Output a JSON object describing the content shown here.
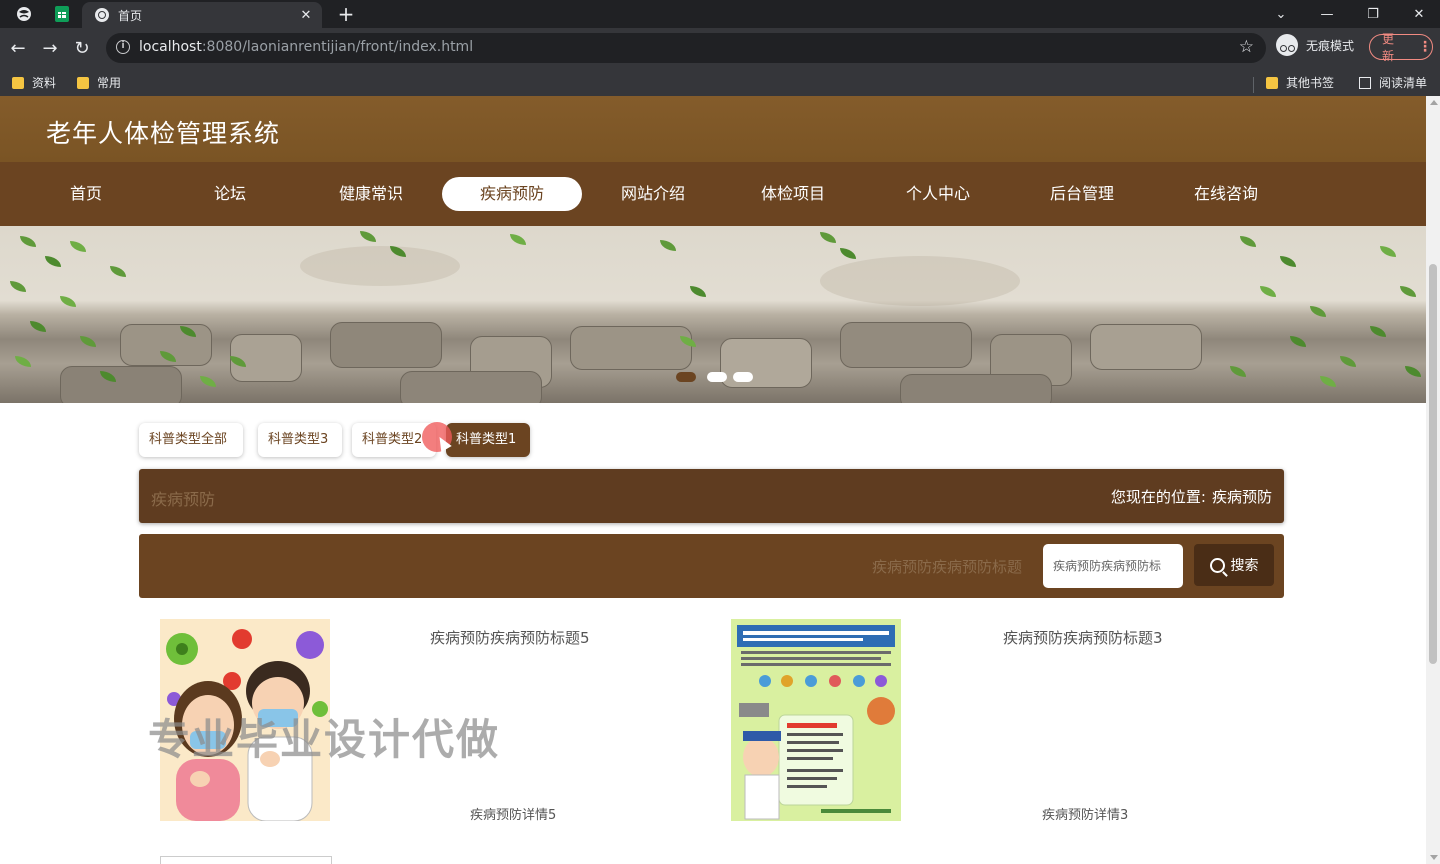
{
  "browser": {
    "tab_title": "首页",
    "url_host": "localhost",
    "url_rest": ":8080/laonianrentijian/front/index.html",
    "incognito_label": "无痕模式",
    "update_label": "更新",
    "bookmarks": [
      "资料",
      "常用"
    ],
    "bookmarks_right": [
      "其他书签",
      "阅读清单"
    ]
  },
  "site": {
    "title": "老年人体检管理系统",
    "nav": [
      "首页",
      "论坛",
      "健康常识",
      "疾病预防",
      "网站介绍",
      "体检项目",
      "个人中心",
      "后台管理",
      "在线咨询"
    ],
    "active_nav": "疾病预防"
  },
  "filters": {
    "types": [
      "科普类型全部",
      "科普类型3",
      "科普类型2",
      "科普类型1"
    ],
    "active": "科普类型1"
  },
  "breadcrumb_bar": {
    "section": "疾病预防",
    "location_label": "您现在的位置:",
    "location": "疾病预防"
  },
  "search": {
    "label": "疾病预防疾病预防标题",
    "placeholder": "疾病预防疾病预防标",
    "button": "搜索"
  },
  "cards": [
    {
      "title": "疾病预防疾病预防标题5",
      "detail": "疾病预防详情5"
    },
    {
      "title": "疾病预防疾病预防标题3",
      "detail": "疾病预防详情3"
    }
  ],
  "watermark": "专业毕业设计代做",
  "colors": {
    "header": "#845c2b",
    "nav": "#6b4421",
    "bar_dark": "#5f3c20",
    "accent": "#6b4421"
  }
}
